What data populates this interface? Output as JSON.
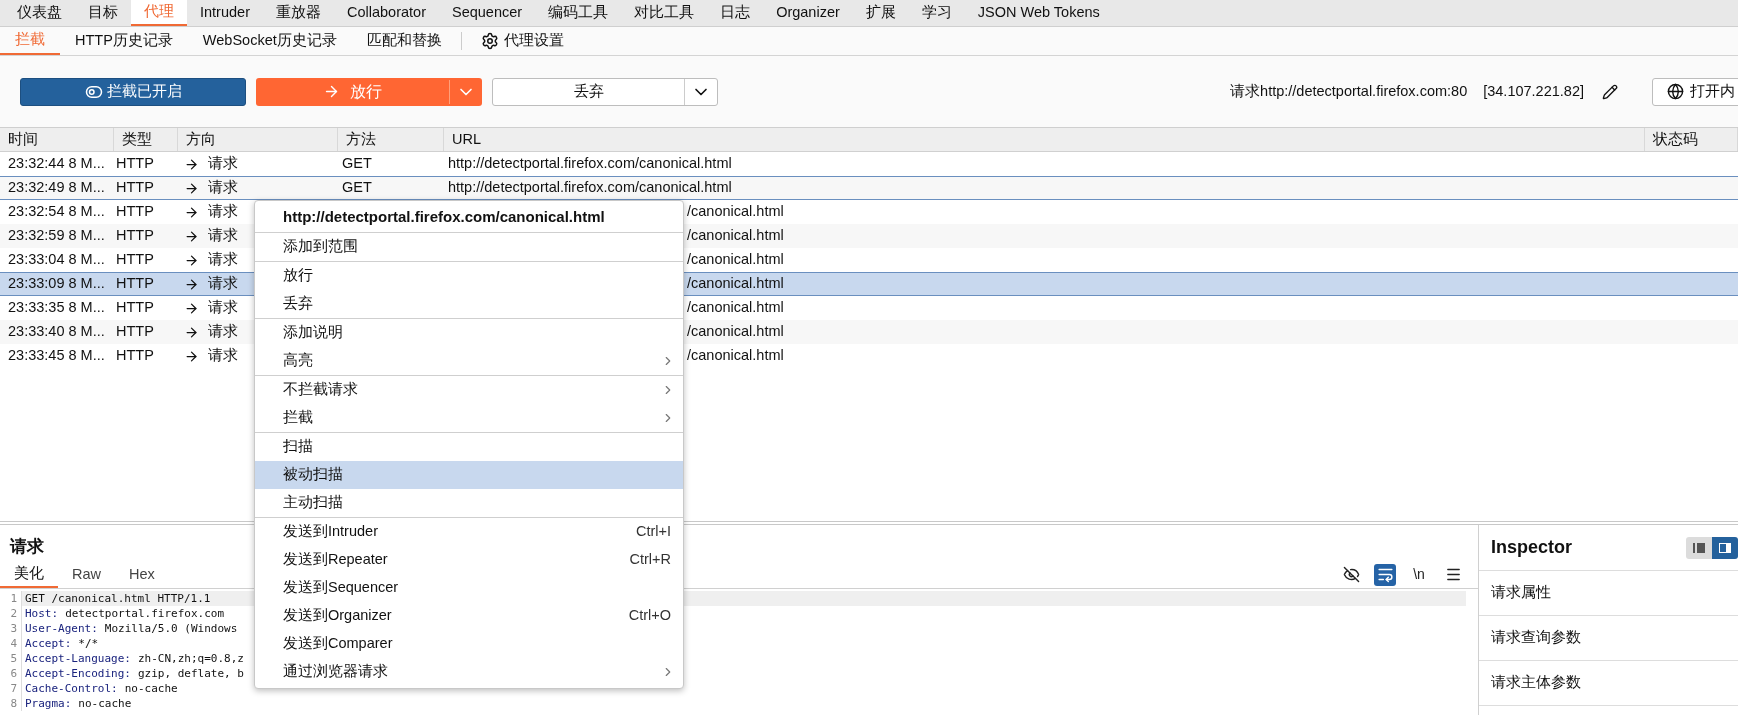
{
  "top_tabs": [
    {
      "label": "仪表盘",
      "selected": false
    },
    {
      "label": "目标",
      "selected": false
    },
    {
      "label": "代理",
      "selected": true
    },
    {
      "label": "Intruder",
      "selected": false
    },
    {
      "label": "重放器",
      "selected": false
    },
    {
      "label": "Collaborator",
      "selected": false
    },
    {
      "label": "Sequencer",
      "selected": false
    },
    {
      "label": "编码工具",
      "selected": false
    },
    {
      "label": "对比工具",
      "selected": false
    },
    {
      "label": "日志",
      "selected": false
    },
    {
      "label": "Organizer",
      "selected": false
    },
    {
      "label": "扩展",
      "selected": false
    },
    {
      "label": "学习",
      "selected": false
    },
    {
      "label": "JSON Web Tokens",
      "selected": false
    }
  ],
  "sub_tabs": [
    {
      "label": "拦截",
      "selected": true,
      "kind": "tab"
    },
    {
      "label": "HTTP历史记录",
      "selected": false,
      "kind": "tab"
    },
    {
      "label": "WebSocket历史记录",
      "selected": false,
      "kind": "tab"
    },
    {
      "label": "匹配和替换",
      "selected": false,
      "kind": "tab"
    },
    {
      "label": "代理设置",
      "selected": false,
      "kind": "settings"
    }
  ],
  "toolbar": {
    "intercept": {
      "label": "拦截已开启",
      "on": true
    },
    "forward": "放行",
    "drop": "丢弃",
    "target": "请求http://detectportal.firefox.com:80",
    "ip": "[34.107.221.82]",
    "open_browser": "打开内"
  },
  "table": {
    "columns": [
      "时间",
      "类型",
      "方向",
      "方法",
      "URL",
      "状态码"
    ],
    "rows": [
      {
        "time": "23:32:44 8 M...",
        "type": "HTTP",
        "direction": "请求",
        "method": "GET",
        "url": "http://detectportal.firefox.com/canonical.html",
        "selected": false,
        "focused": false
      },
      {
        "time": "23:32:49 8 M...",
        "type": "HTTP",
        "direction": "请求",
        "method": "GET",
        "url": "http://detectportal.firefox.com/canonical.html",
        "selected": false,
        "focused": true
      },
      {
        "time": "23:32:54 8 M...",
        "type": "HTTP",
        "direction": "请求",
        "url": "/canonical.html",
        "selected": false,
        "focused": false
      },
      {
        "time": "23:32:59 8 M...",
        "type": "HTTP",
        "direction": "请求",
        "url": "/canonical.html",
        "selected": false,
        "focused": false
      },
      {
        "time": "23:33:04 8 M...",
        "type": "HTTP",
        "direction": "请求",
        "url": "/canonical.html",
        "selected": false,
        "focused": false
      },
      {
        "time": "23:33:09 8 M...",
        "type": "HTTP",
        "direction": "请求",
        "url": "/canonical.html",
        "selected": true,
        "focused": false
      },
      {
        "time": "23:33:35 8 M...",
        "type": "HTTP",
        "direction": "请求",
        "url": "/canonical.html",
        "selected": false,
        "focused": false
      },
      {
        "time": "23:33:40 8 M...",
        "type": "HTTP",
        "direction": "请求",
        "url": "/canonical.html",
        "selected": false,
        "focused": false
      },
      {
        "time": "23:33:45 8 M...",
        "type": "HTTP",
        "direction": "请求",
        "url": "/canonical.html",
        "selected": false,
        "focused": false
      }
    ]
  },
  "context_menu": {
    "title": "http://detectportal.firefox.com/canonical.html",
    "groups": [
      [
        {
          "label": "添加到范围",
          "selected": false,
          "submenu": false
        }
      ],
      [
        {
          "label": "放行",
          "selected": false,
          "submenu": false
        },
        {
          "label": "丢弃",
          "selected": false,
          "submenu": false
        }
      ],
      [
        {
          "label": "添加说明",
          "selected": false,
          "submenu": false
        },
        {
          "label": "高亮",
          "selected": false,
          "submenu": true
        }
      ],
      [
        {
          "label": "不拦截请求",
          "selected": false,
          "submenu": true
        },
        {
          "label": "拦截",
          "selected": false,
          "submenu": true
        }
      ],
      [
        {
          "label": "扫描",
          "selected": false,
          "submenu": false
        },
        {
          "label": "被动扫描",
          "selected": true,
          "submenu": false
        },
        {
          "label": "主动扫描",
          "selected": false,
          "submenu": false
        }
      ],
      [
        {
          "label": "发送到Intruder",
          "shortcut": "Ctrl+I",
          "selected": false,
          "submenu": false
        },
        {
          "label": "发送到Repeater",
          "shortcut": "Ctrl+R",
          "selected": false,
          "submenu": false
        },
        {
          "label": "发送到Sequencer",
          "selected": false,
          "submenu": false
        },
        {
          "label": "发送到Organizer",
          "shortcut": "Ctrl+O",
          "selected": false,
          "submenu": false
        },
        {
          "label": "发送到Comparer",
          "selected": false,
          "submenu": false
        },
        {
          "label": "通过浏览器请求",
          "selected": false,
          "submenu": true
        }
      ]
    ]
  },
  "request": {
    "title": "请求",
    "tabs": [
      {
        "label": "美化",
        "selected": true
      },
      {
        "label": "Raw",
        "selected": false
      },
      {
        "label": "Hex",
        "selected": false
      }
    ],
    "tools": [
      {
        "kind": "hide",
        "on": false
      },
      {
        "kind": "wrap",
        "on": true
      },
      {
        "kind": "newline",
        "label": "\\n",
        "on": false
      },
      {
        "kind": "menu",
        "on": false
      }
    ],
    "lines": [
      {
        "number": "1",
        "kind": "request-line",
        "text": "GET /canonical.html HTTP/1.1",
        "current": true
      },
      {
        "number": "2",
        "kind": "header",
        "name": "Host:",
        "value": "detectportal.firefox.com",
        "current": false
      },
      {
        "number": "3",
        "kind": "header",
        "name": "User-Agent:",
        "value": "Mozilla/5.0 (Windows",
        "current": false
      },
      {
        "number": "4",
        "kind": "header",
        "name": "Accept:",
        "value": "*/*",
        "current": false
      },
      {
        "number": "5",
        "kind": "header",
        "name": "Accept-Language:",
        "value": "zh-CN,zh;q=0.8,z",
        "current": false
      },
      {
        "number": "6",
        "kind": "header",
        "name": "Accept-Encoding:",
        "value": "gzip, deflate, b",
        "current": false
      },
      {
        "number": "7",
        "kind": "header",
        "name": "Cache-Control:",
        "value": "no-cache",
        "current": false
      },
      {
        "number": "8",
        "kind": "header",
        "name": "Pragma:",
        "value": "no-cache",
        "current": false
      }
    ]
  },
  "inspector": {
    "title": "Inspector",
    "layouts": [
      {
        "kind": "stacked",
        "selected": false
      },
      {
        "kind": "side",
        "selected": true
      }
    ],
    "sections": [
      "请求属性",
      "请求查询参数",
      "请求主体参数"
    ]
  }
}
